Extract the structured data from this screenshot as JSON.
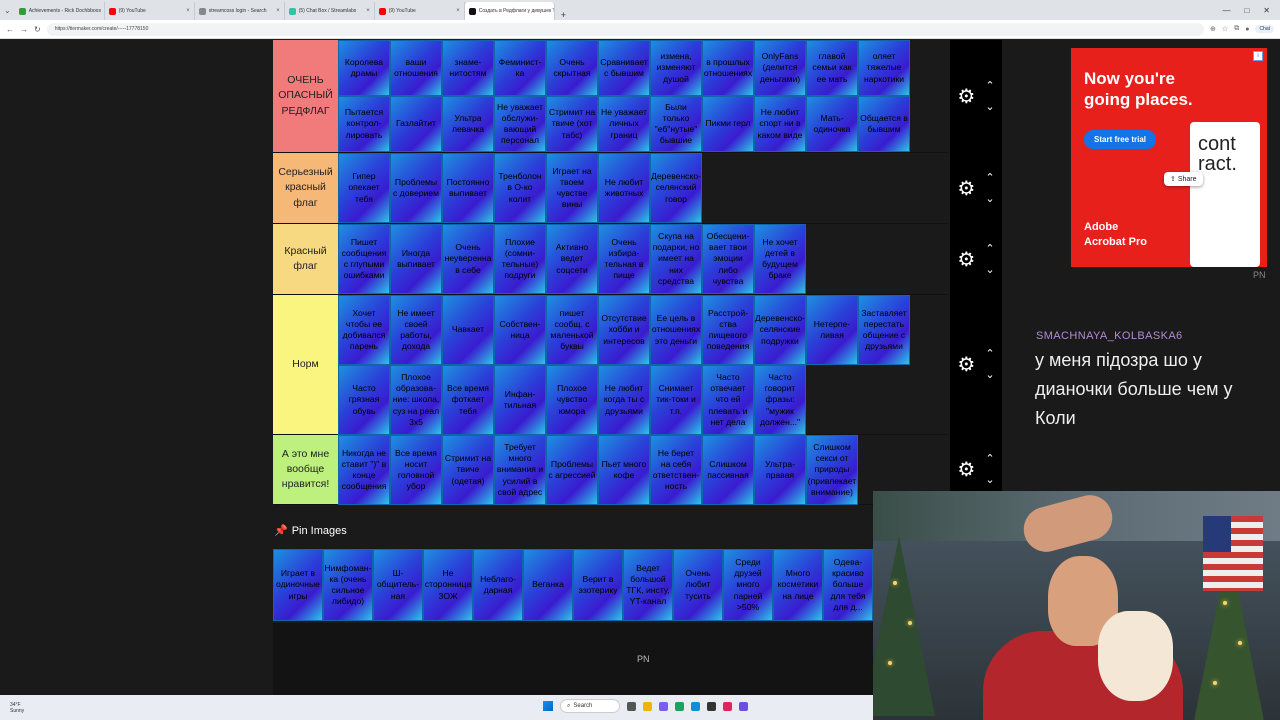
{
  "browser": {
    "tabs": [
      {
        "label": "Achievements - Rick Dochbboos",
        "color": "#2f9e3a"
      },
      {
        "label": "(9) YouTube",
        "color": "#ff0000"
      },
      {
        "label": "streamcoss login - Search",
        "color": "#888888"
      },
      {
        "label": "(5) Chat Box / Streamlabs",
        "color": "#31c3a2"
      },
      {
        "label": "(9) YouTube",
        "color": "#ff0000"
      },
      {
        "label": "Создать в Редфлаги у девушек Ти...",
        "color": "#111111",
        "active": true
      }
    ],
    "new_tab": "+",
    "url": "https://tiermaker.com/create/-----17778150",
    "chat_label": "Chat"
  },
  "tiers": [
    {
      "label": "ОЧЕНЬ ОПАСНЫЙ РЕДФЛАГ",
      "color": "#f17b7b",
      "items": [
        "Королева драмы",
        "ваши отношения",
        "знаме-нитостям",
        "Феминист-ка",
        "Очень скрытная",
        "Сравнивает с бывшим",
        "измена, изменяют душой",
        "в прошлых отношениях",
        "OnlyFans (делится деньгами)",
        "главой семьи как ее мать",
        "оляет тяжелые наркотики",
        "Пытается контрол-лировать",
        "Газлайтит",
        "Ультра левачка",
        "Не уважает обслужи-вающий персонал",
        "Стримит на твиче (хот табс)",
        "Не уважает личных границ",
        "Были только \"еб\"нутые\" бывшие",
        "Пикми герл",
        "Не любит спорт ни в каком виде",
        "Мать-одиночка",
        "Общается в бывшим"
      ]
    },
    {
      "label": "Серьезный красный флаг",
      "color": "#f5b877",
      "items": [
        "Гипер опекает тебя",
        "Проблемы с доверием",
        "Постоянно выпивает",
        "Тренболон в О-ко колит",
        "Играет на твоем чувстве вины",
        "Не любит животных",
        "Деревенско-селянский говор"
      ]
    },
    {
      "label": "Красный флаг",
      "color": "#f7d982",
      "items": [
        "Пишет сообщения с глупыми ошибками",
        "Иногда выпивает",
        "Очень неуверенна в себе",
        "Плохие (сомни-тельные) подруги",
        "Активно ведет соцсети",
        "Очень избира-тельная в пище",
        "Скупа на подарки, но имеет на них средства",
        "Обесцени-вает твои эмоции либо чувства",
        "Не хочет детей в будущем браке"
      ]
    },
    {
      "label": "Норм",
      "color": "#f9f57e",
      "items": [
        "Хочет чтобы ее добивался парень",
        "Не имеет своей работы, дохода",
        "Чавкает",
        "Собствен-ница",
        "пишет сообщ. с маленькой буквы",
        "Отсутствие хобби и интересов",
        "Ее цель в отношениях это деньги",
        "Расстрой-ства пищевого поведения",
        "Деревенско-селянские подружки",
        "Нетерпе-ливая",
        "Заставляет перестать общение с друзьями",
        "Часто грязная обувь",
        "Плохое образова-ние: школа, суз на реал 3х5",
        "Все время фоткает тебя",
        "Инфан-тильная",
        "Плохое чувство юмора",
        "Не любит когда ты с друзьями",
        "Снимает тик-токи и т.п.",
        "Часто отвечает что ей плевать и нет дела",
        "Часто говорит фразы: \"мужик должен...\""
      ]
    },
    {
      "label": "А это мне вообще нравится!",
      "color": "#bdf07c",
      "items": [
        "Никогда не ставит \")\" в конце сообщения",
        "Все время носит головной убор",
        "Стримит на твиче (одетая)",
        "Требует много внимания и усилий в свой адрес",
        "Проблемы с агрессией",
        "Пьет много кофе",
        "Не берет на себя ответствен-ность",
        "Слишком пассивная",
        "Ультра-правая",
        "Слишком секси от природы (привлекает внимание)"
      ]
    }
  ],
  "pin_images": {
    "title": "Pin Images",
    "items": [
      "Играет в одиночные игры",
      "Нимфоман-ка (очень сильное либидо)",
      "Ш-общитель-ная",
      "Не сторонница ЗОЖ",
      "Неблаго-дарная",
      "Веганка",
      "Верит в эзотерику",
      "Ведет большой ТГК, инсту, YT-канал",
      "Очень любит тусить",
      "Среди друзей много парней >50%",
      "Много косметики на лице",
      "Одева-красиво больше для тебя для д..."
    ]
  },
  "overlay_pn": "PN",
  "ad": {
    "headline": "Now you're going places.",
    "button": "Start free trial",
    "brand_line1": "Adobe",
    "brand_line2": "Acrobat Pro",
    "doc_text": "cont ract.",
    "share": "Share",
    "adchoices": "i",
    "pn": "PN"
  },
  "chat": {
    "username": "SMACHNAYA_KOLBASKA6",
    "message": "у меня підозра шо у дианочки больше чем у Коли"
  },
  "taskbar": {
    "weather_temp": "34°F",
    "weather_desc": "Sunny",
    "search": "Search"
  },
  "icons": {
    "gear": "gear-icon",
    "up": "chevron-up-icon",
    "down": "chevron-down-icon",
    "pin": "pushpin-icon"
  }
}
